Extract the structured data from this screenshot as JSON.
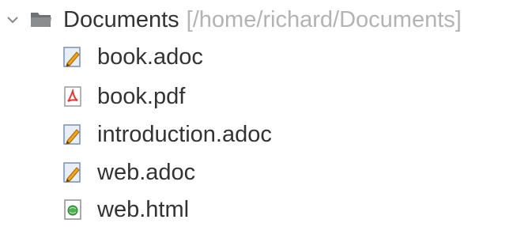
{
  "tree": {
    "root": {
      "label": "Documents",
      "path": "[/home/richard/Documents]",
      "expanded": true,
      "icon": "folder-icon"
    },
    "files": [
      {
        "name": "book.adoc",
        "icon": "text-edit-icon"
      },
      {
        "name": "book.pdf",
        "icon": "pdf-icon"
      },
      {
        "name": "introduction.adoc",
        "icon": "text-edit-icon"
      },
      {
        "name": "web.adoc",
        "icon": "text-edit-icon"
      },
      {
        "name": "web.html",
        "icon": "html-file-icon"
      }
    ]
  },
  "colors": {
    "text": "#333333",
    "path": "#b3b3b3",
    "folder": "#6f7072",
    "pdf_red": "#e53935",
    "pencil": "#f0a21c"
  }
}
